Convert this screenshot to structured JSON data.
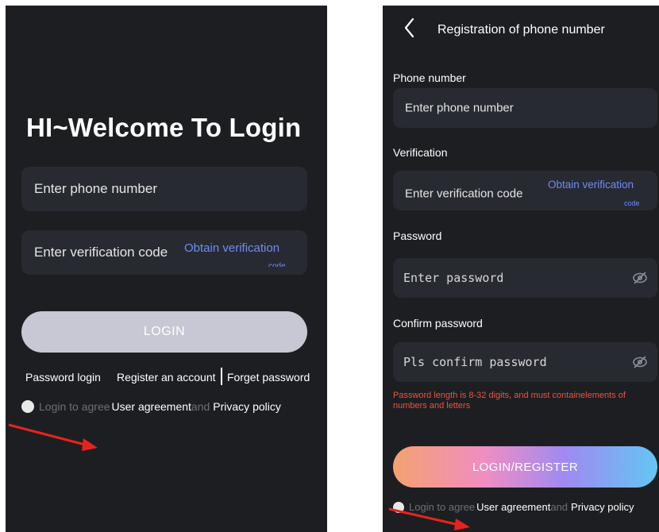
{
  "login": {
    "title": "HI~Welcome To Login",
    "phone_placeholder": "Enter phone number",
    "code_placeholder": "Enter verification code",
    "obtain_label": "Obtain verification",
    "obtain_overflow": "code",
    "login_button": "LOGIN",
    "password_login": "Password login",
    "register_account": "Register an account",
    "forget_password": "Forget password",
    "agree_prefix": "Login to agree",
    "user_agreement": "User agreement",
    "and": "and",
    "privacy_policy": "Privacy policy"
  },
  "register": {
    "header_title": "Registration of phone number",
    "phone_label": "Phone number",
    "phone_placeholder": "Enter phone number",
    "verification_label": "Verification",
    "code_placeholder": "Enter verification code",
    "obtain_label": "Obtain verification",
    "obtain_overflow": "code",
    "password_label": "Password",
    "password_placeholder": "Enter password",
    "confirm_label": "Confirm password",
    "confirm_placeholder": "Pls confirm password",
    "hint": "Password length is 8-32 digits, and must containelements of numbers and letters",
    "submit_button": "LOGIN/REGISTER",
    "agree_prefix": "Login to agree",
    "user_agreement": "User agreement",
    "and": "and",
    "privacy_policy": "Privacy policy"
  },
  "icons": {
    "back": "chevron-left-icon",
    "eye_hidden": "eye-off-icon",
    "annotation": "red-arrow-icon"
  },
  "colors": {
    "screen_bg": "#1d1e22",
    "field_bg": "#282a31",
    "link_blue": "#6f8cf7",
    "hint_red": "#e8553e",
    "login_btn": "#c8c8d4",
    "arrow_red": "#e8231d"
  }
}
